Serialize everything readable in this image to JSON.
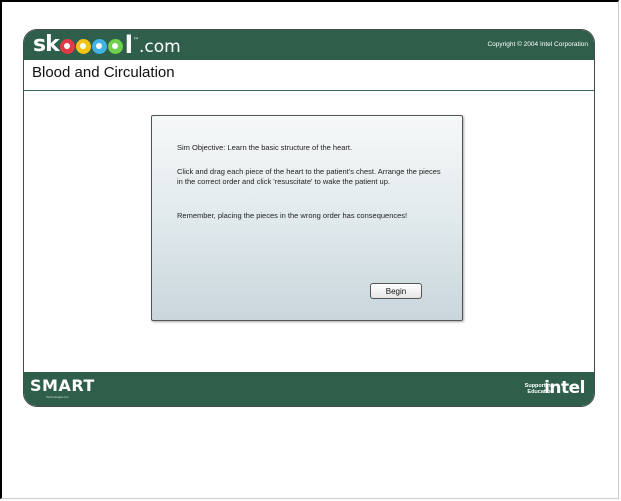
{
  "header": {
    "logo": {
      "sk": "sk",
      "l": "l",
      "com": ".com",
      "tm": "™"
    },
    "copyright": "Copyright © 2004 Intel Corporation"
  },
  "page": {
    "title": "Blood and Circulation"
  },
  "dialog": {
    "objective": "Sim Objective: Learn the basic structure of the heart.",
    "instructions": "Click and drag each piece of the heart to the patient's chest. Arrange the pieces in the correct order and click 'resuscitate' to wake the patient up.",
    "warning": "Remember, placing the pieces in the wrong order has consequences!",
    "begin_label": "Begin"
  },
  "footer": {
    "smart_logo": "SMART",
    "smart_sub": "Technologies Inc.",
    "supporting": "Supporting Education",
    "intel_logo": "intel"
  },
  "colors": {
    "bar": "#2f5f4a",
    "dialog_bg": "#dfe8eb"
  },
  "icons": [
    "skoool-logo",
    "smart-logo",
    "intel-logo"
  ]
}
